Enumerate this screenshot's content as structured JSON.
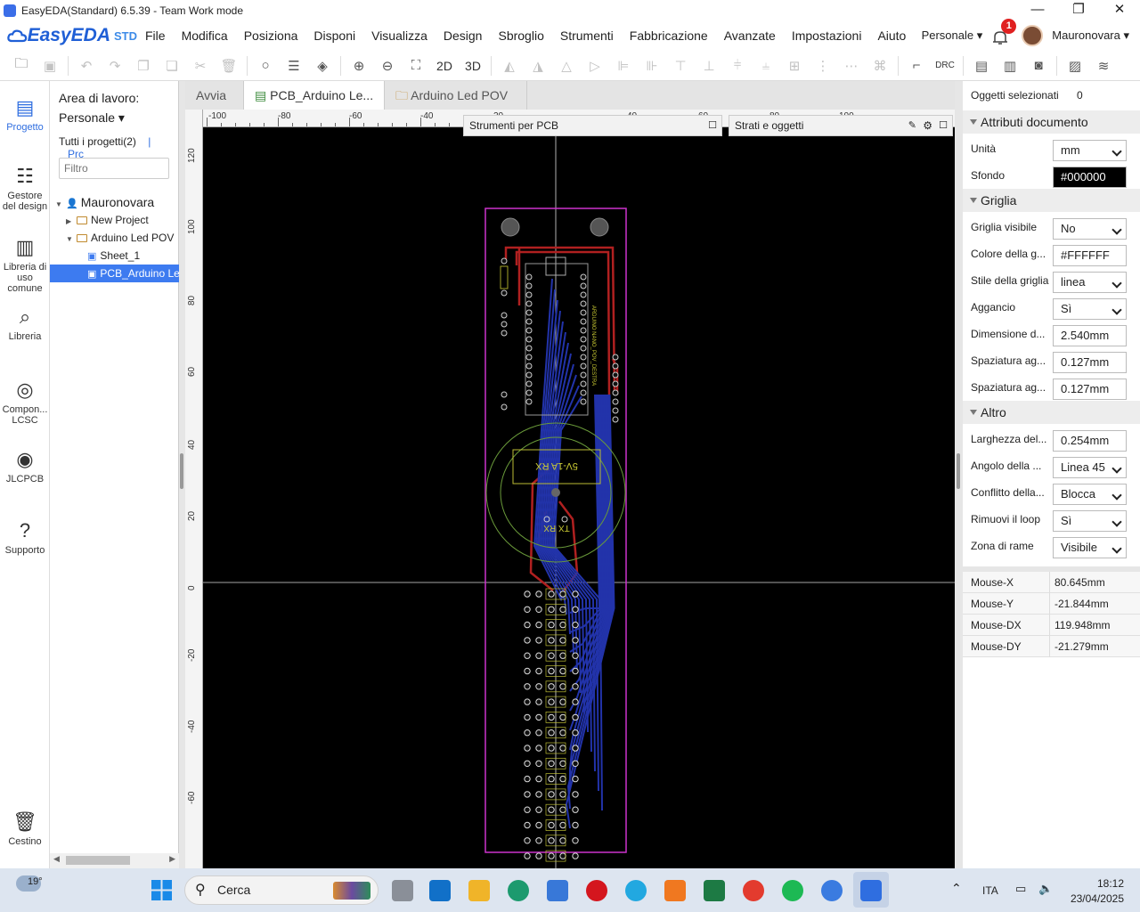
{
  "window": {
    "title": "EasyEDA(Standard) 6.5.39 - Team Work mode"
  },
  "logo": {
    "brand": "EasyEDA",
    "edition": "STD"
  },
  "menu": [
    "File",
    "Modifica",
    "Posiziona",
    "Disponi",
    "Visualizza",
    "Design",
    "Sbroglio",
    "Strumenti",
    "Fabbricazione",
    "Avanzate",
    "Impostazioni",
    "Aiuto"
  ],
  "account": {
    "workspace": "Personale ▾",
    "notifications": "1",
    "user": "Mauronovara ▾"
  },
  "toolbar": {
    "view_2d": "2D",
    "view_3d": "3D",
    "drc": "DRC"
  },
  "sidebar": [
    {
      "label": "Progetto",
      "icon": "folder-icon"
    },
    {
      "label": "Gestore del design",
      "icon": "list-icon"
    },
    {
      "label": "Libreria di uso comune",
      "icon": "chip-icon"
    },
    {
      "label": "Libreria",
      "icon": "library-search-icon"
    },
    {
      "label": "Compon... LCSC",
      "icon": "lcsc-icon"
    },
    {
      "label": "JLCPCB",
      "icon": "jlc-icon"
    },
    {
      "label": "Supporto",
      "icon": "help-icon"
    },
    {
      "label": "Cestino",
      "icon": "trash-icon"
    }
  ],
  "project_panel": {
    "workspace_label": "Area di lavoro:",
    "workspace_value": "Personale ▾",
    "all_projects": "Tutti i progetti(2)",
    "separator": "|",
    "link": "Prc",
    "filter_placeholder": "Filtro",
    "tree": [
      {
        "label": "Mauronovara",
        "level": 0
      },
      {
        "label": "New Project",
        "level": 1
      },
      {
        "label": "Arduino Led POV",
        "level": 1
      },
      {
        "label": "Sheet_1",
        "level": 2
      },
      {
        "label": "PCB_Arduino Le",
        "level": 2
      }
    ]
  },
  "tabs": [
    "Avvia",
    "PCB_Arduino Le...",
    "Arduino Led POV"
  ],
  "canvas": {
    "ruler_top": [
      "-100",
      "-80",
      "-60",
      "-40",
      "20",
      "40",
      "60",
      "80",
      "100"
    ],
    "ruler_left": [
      "120",
      "100",
      "80",
      "60",
      "40",
      "20",
      "0",
      "-20",
      "-40",
      "-60"
    ],
    "pcb_tools_label": "Strumenti per PCB",
    "layers_label": "Strati e oggetti",
    "silk_text": [
      "5V-1A RX",
      "TX RX",
      "ARDUINO NANO_POV_DESTRA"
    ]
  },
  "right_panel": {
    "selected_label": "Oggetti selezionati",
    "selected_count": "0",
    "doc_section": "Attributi documento",
    "doc_rows": [
      {
        "label": "Unità",
        "value": "mm",
        "type": "select"
      },
      {
        "label": "Sfondo",
        "value": "#000000",
        "type": "color"
      }
    ],
    "grid_section": "Griglia",
    "grid_rows": [
      {
        "label": "Griglia visibile",
        "value": "No",
        "type": "select"
      },
      {
        "label": "Colore della g...",
        "value": "#FFFFFF",
        "type": "text"
      },
      {
        "label": "Stile della griglia",
        "value": "linea",
        "type": "select"
      },
      {
        "label": "Aggancio",
        "value": "Sì",
        "type": "select"
      },
      {
        "label": "Dimensione d...",
        "value": "2.540mm",
        "type": "text"
      },
      {
        "label": "Spaziatura ag...",
        "value": "0.127mm",
        "type": "text"
      },
      {
        "label": "Spaziatura ag...",
        "value": "0.127mm",
        "type": "text"
      }
    ],
    "other_section": "Altro",
    "other_rows": [
      {
        "label": "Larghezza del...",
        "value": "0.254mm",
        "type": "text"
      },
      {
        "label": "Angolo della ...",
        "value": "Linea 45",
        "type": "select"
      },
      {
        "label": "Conflitto della...",
        "value": "Blocca",
        "type": "select"
      },
      {
        "label": "Rimuovi il loop",
        "value": "Sì",
        "type": "select"
      },
      {
        "label": "Zona di rame",
        "value": "Visibile",
        "type": "select"
      }
    ],
    "mouse": [
      {
        "label": "Mouse-X",
        "value": "80.645mm"
      },
      {
        "label": "Mouse-Y",
        "value": "-21.844mm"
      },
      {
        "label": "Mouse-DX",
        "value": "119.948mm"
      },
      {
        "label": "Mouse-DY",
        "value": "-21.279mm"
      }
    ]
  },
  "taskbar": {
    "weather": "19°",
    "search": "Cerca",
    "lang": "ITA",
    "time": "18:12",
    "date": "23/04/2025"
  },
  "colors": {
    "accent": "#2f6ee0",
    "board_outline": "#cc33cc",
    "top_copper": "#cc2222",
    "bottom_copper": "#2233bb",
    "silk": "#cccc33"
  }
}
